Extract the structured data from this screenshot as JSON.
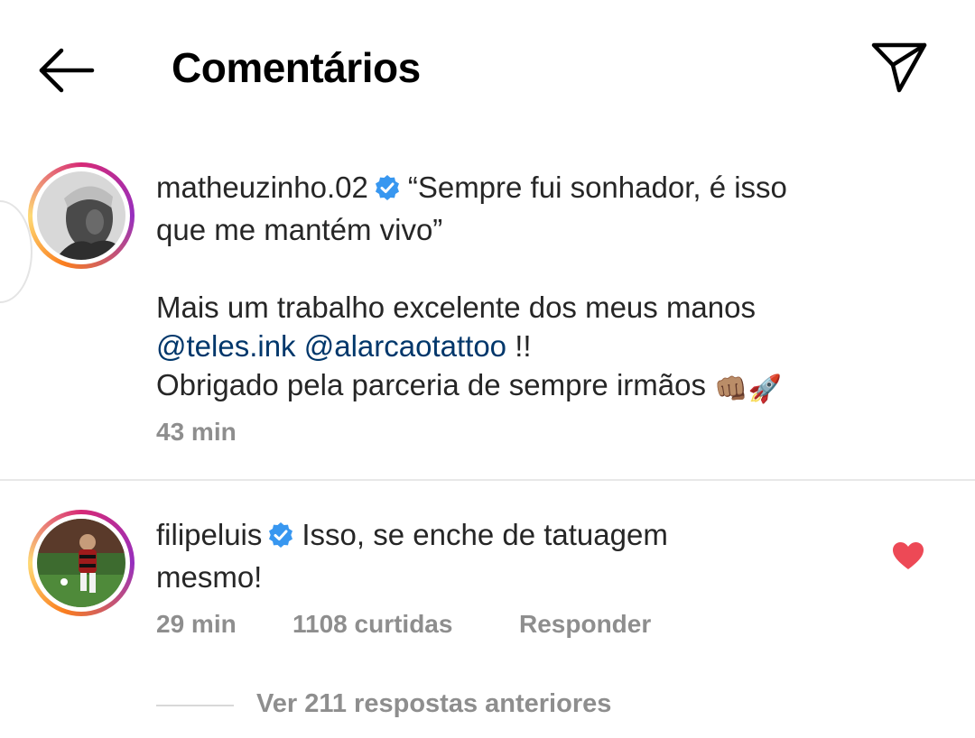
{
  "header": {
    "title": "Comentários",
    "back_icon": "arrow-left-icon",
    "share_icon": "paper-plane-icon"
  },
  "caption": {
    "username": "matheuzinho.02",
    "verified": true,
    "line1": "“Sempre fui sonhador, é isso",
    "line2": "que me mantém vivo”",
    "line3": "Mais um trabalho excelente dos meus manos",
    "mention1": "@teles.ink",
    "mention2": "@alarcaotattoo",
    "after_mentions": " !!",
    "line5": "Obrigado pela parceria de sempre irmãos",
    "emoji1": "👊🏽",
    "emoji2": "🚀",
    "time": "43 min"
  },
  "comment": {
    "username": "filipeluis",
    "verified": true,
    "line1": "Isso, se enche de tatuagem",
    "line2": "mesmo!",
    "time": "29 min",
    "likes": "1108 curtidas",
    "reply_label": "Responder",
    "liked": true
  },
  "replies": {
    "label": "Ver 211 respostas anteriores"
  },
  "colors": {
    "mention": "#00376b",
    "verified": "#3897f0",
    "heart": "#ed4956",
    "meta": "#8e8e8e"
  }
}
